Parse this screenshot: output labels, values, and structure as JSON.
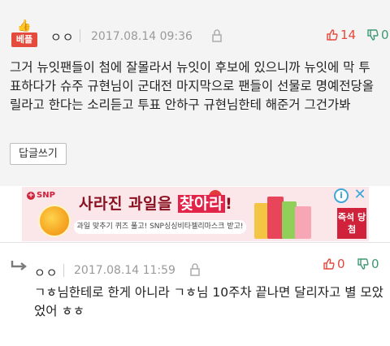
{
  "best_comment": {
    "badge": "베플",
    "author": "ㅇㅇ",
    "timestamp": "2017.08.14 09:36",
    "likes": "14",
    "dislikes": "0",
    "text": "그거 뉴잇팬들이 첨에 잘몰라서 뉴잇이 후보에 있으니까 뉴잇에 막 투표하다가 슈주 규현님이 군대전 마지막으로 팬들이 선물로 명예전당올릴라고 한다는 소리듣고 투표 안하구 규현님한테 해준거 그건가봐",
    "reply_button": "답글쓰기"
  },
  "ad": {
    "brand": "SNP",
    "headline_before": "사라진 과일을 ",
    "headline_highlight": "찾아라",
    "headline_after": "!",
    "subtext": "과일 맞추기 퀴즈 풀고! SNP싱싱비타젤리마스크 받고!",
    "cta": "즉석 당첨",
    "info_icon": "info-icon",
    "close_icon": "close-icon"
  },
  "reply_comment": {
    "author": "ㅇㅇ",
    "timestamp": "2017.08.14 11:59",
    "likes": "0",
    "dislikes": "0",
    "text": "ㄱㅎ님한테로 한게 아니라 ㄱㅎ님 10주차 끝나면 달리자고 별 모았었어 ㅎㅎ"
  },
  "colors": {
    "accent_red": "#e5473b",
    "accent_green": "#3d9970",
    "best_bg": "#f4f4f4",
    "meta_gray": "#9a9a9a"
  }
}
